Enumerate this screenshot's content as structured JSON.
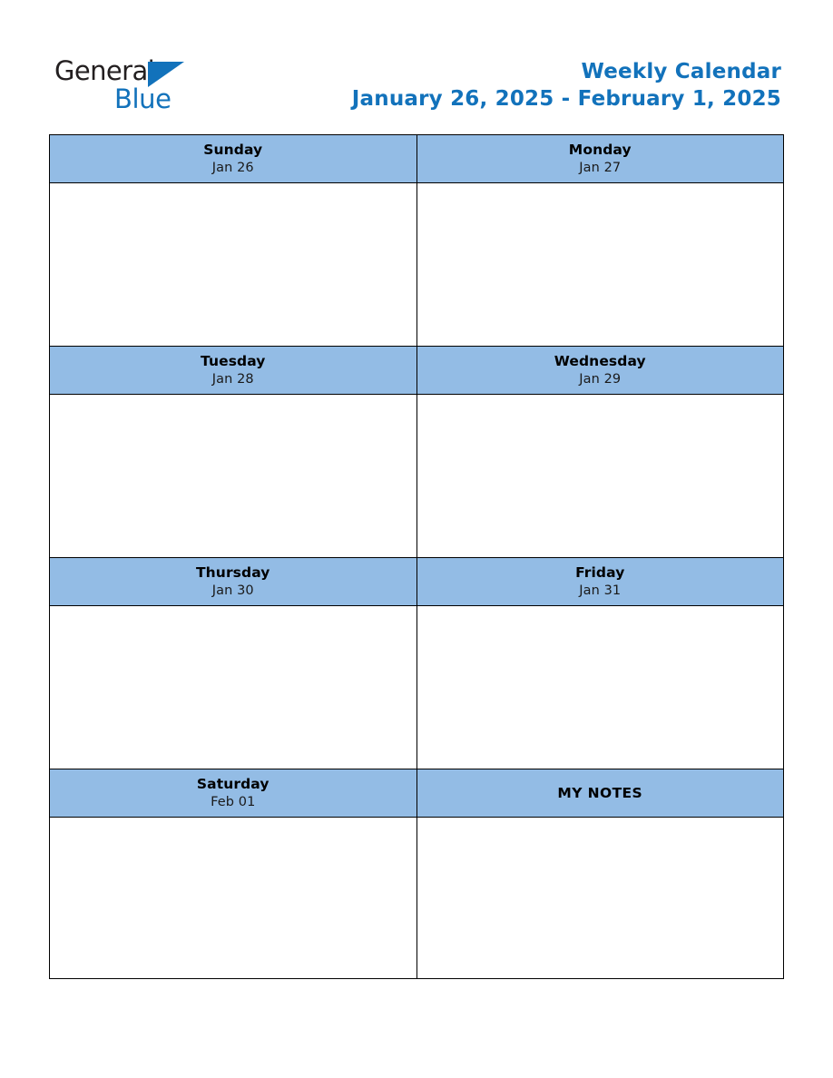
{
  "page": {
    "background_color": "#ffffff",
    "accent_color": "#1272bb",
    "header_cell_color": "#93bce5",
    "border_color": "#000000"
  },
  "logo": {
    "word_one": "General",
    "word_two": "Blue",
    "word_one_color": "#231f20",
    "word_two_color": "#1272bb",
    "triangle_color": "#1272bb",
    "triangle_icon": "right-triangle-icon"
  },
  "header": {
    "title": "Weekly Calendar",
    "date_range": "January 26, 2025 - February 1, 2025"
  },
  "calendar": {
    "rows": [
      {
        "left": {
          "day": "Sunday",
          "date": "Jan 26",
          "note_cell": false
        },
        "right": {
          "day": "Monday",
          "date": "Jan 27",
          "note_cell": false
        }
      },
      {
        "left": {
          "day": "Tuesday",
          "date": "Jan 28",
          "note_cell": false
        },
        "right": {
          "day": "Wednesday",
          "date": "Jan 29",
          "note_cell": false
        }
      },
      {
        "left": {
          "day": "Thursday",
          "date": "Jan 30",
          "note_cell": false
        },
        "right": {
          "day": "Friday",
          "date": "Jan 31",
          "note_cell": false
        }
      },
      {
        "left": {
          "day": "Saturday",
          "date": "Feb 01",
          "note_cell": false
        },
        "right": {
          "day": "MY NOTES",
          "date": "",
          "note_cell": true
        }
      }
    ]
  }
}
